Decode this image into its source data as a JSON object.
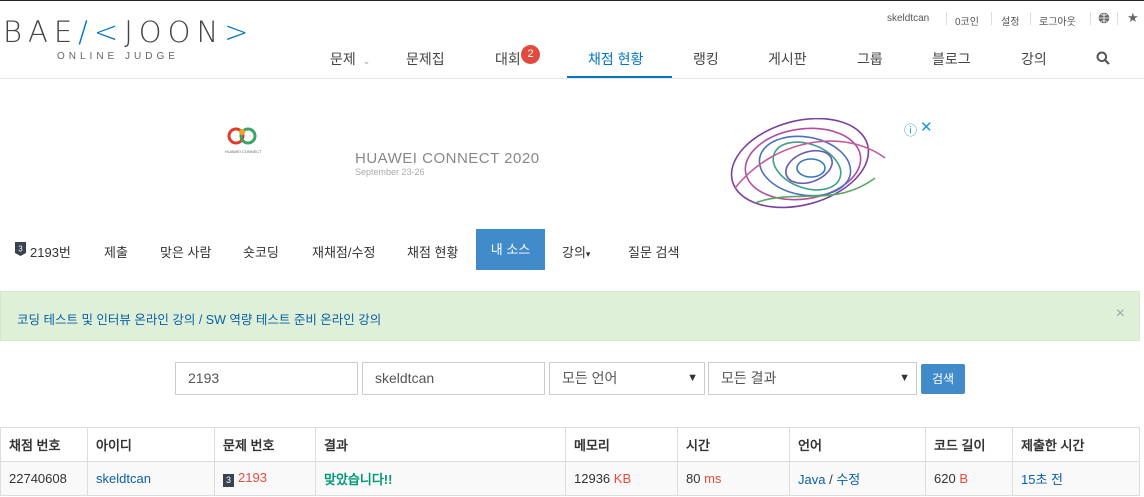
{
  "header": {
    "logo_left": "BAE",
    "logo_mid": "K",
    "logo_right": "JOON",
    "logo_sub": "ONLINE JUDGE",
    "util": {
      "user": "skeldtcan",
      "coin": "0코인",
      "settings": "설정",
      "logout": "로그아웃"
    },
    "nav": [
      "문제",
      "문제집",
      "대회",
      "채점 현황",
      "랭킹",
      "게시판",
      "그룹",
      "블로그",
      "강의"
    ],
    "nav_badge": "2",
    "nav_active": "채점 현황"
  },
  "ad": {
    "title": "HUAWEI CONNECT 2020",
    "date": "September 23-26",
    "logo_text": "HUAWEI CONNECT"
  },
  "problem_menu": {
    "problem_number": "2193번",
    "items": [
      "제출",
      "맞은 사람",
      "숏코딩",
      "재채점/수정",
      "채점 현황",
      "내 소스",
      "강의",
      "질문 검색"
    ],
    "active": "내 소스"
  },
  "alert": {
    "text": "코딩 테스트 및 인터뷰 온라인 강의 / SW 역량 테스트 준비 온라인 강의",
    "close": "×"
  },
  "search": {
    "problem_id": "2193",
    "user_id": "skeldtcan",
    "language": "모든 언어",
    "result": "모든 결과",
    "button": "검색"
  },
  "table": {
    "headers": [
      "채점 번호",
      "아이디",
      "문제 번호",
      "결과",
      "메모리",
      "시간",
      "언어",
      "코드 길이",
      "제출한 시간"
    ],
    "row": {
      "submission_id": "22740608",
      "user": "skeldtcan",
      "problem": "2193",
      "result": "맞았습니다!!",
      "memory": "12936",
      "memory_unit": "KB",
      "time": "80",
      "time_unit": "ms",
      "language": "Java",
      "sep": "/",
      "edit": "수정",
      "code_length": "620",
      "code_unit": "B",
      "submitted": "15초 전"
    }
  },
  "colors": {
    "accent": "#0076c0",
    "button": "#428bca",
    "badge": "#e04b3e",
    "alert_bg": "#dff0d8",
    "accepted": "#009874"
  }
}
